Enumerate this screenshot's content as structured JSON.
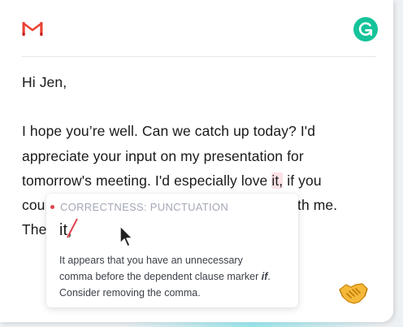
{
  "email": {
    "greeting": "Hi Jen,",
    "line1": "I hope you’re well. Can we catch up today? I'd",
    "line2": "appreciate your input on my presentation for",
    "line3_before": "tomorrow's meeting. I'd especially love ",
    "line3_flagged": "it,",
    "line3_after": " if you",
    "line4_start": "cou",
    "line4_end": "th me.",
    "line5_start": "The"
  },
  "popup": {
    "category": "CORRECTNESS: PUNCTUATION",
    "suggestion_word": "it",
    "removed_char": ",",
    "explanation_line1": "It appears that you have an unnecessary",
    "explanation_line2_before": "comma before the dependent clause marker ",
    "explanation_line2_em": "if",
    "explanation_line2_after": ".",
    "explanation_line3": "Consider removing the comma."
  },
  "icons": {
    "brand_logo": "gmail-icon",
    "assistant_logo": "grammarly-icon",
    "pointer": "cursor-icon",
    "emoji": "handshake-icon"
  },
  "colors": {
    "grammarly_green": "#15C39A",
    "error_red": "#e0424f",
    "highlight": "#fbe2e6",
    "gmail_red": "#EA4335"
  }
}
